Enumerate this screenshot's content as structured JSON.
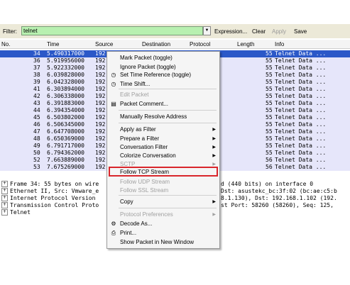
{
  "filter": {
    "label": "Filter:",
    "value": "telnet",
    "actions": [
      "Expression...",
      "Clear",
      "Apply",
      "Save"
    ]
  },
  "columns": [
    "No.",
    "Time",
    "Source",
    "Destination",
    "Protocol",
    "Length",
    "Info"
  ],
  "packets": [
    {
      "no": "34",
      "time": "5.490317000",
      "src": "192",
      "len": "55",
      "info": "Telnet Data ..."
    },
    {
      "no": "36",
      "time": "5.919956000",
      "src": "192",
      "len": "55",
      "info": "Telnet Data ..."
    },
    {
      "no": "37",
      "time": "5.922332000",
      "src": "192",
      "len": "55",
      "info": "Telnet Data ..."
    },
    {
      "no": "38",
      "time": "6.039828000",
      "src": "192",
      "len": "55",
      "info": "Telnet Data ..."
    },
    {
      "no": "39",
      "time": "6.042328000",
      "src": "192",
      "len": "55",
      "info": "Telnet Data ..."
    },
    {
      "no": "41",
      "time": "6.303894000",
      "src": "192",
      "len": "55",
      "info": "Telnet Data ..."
    },
    {
      "no": "42",
      "time": "6.306338000",
      "src": "192",
      "len": "55",
      "info": "Telnet Data ..."
    },
    {
      "no": "43",
      "time": "6.391883000",
      "src": "192",
      "len": "55",
      "info": "Telnet Data ..."
    },
    {
      "no": "44",
      "time": "6.394354000",
      "src": "192",
      "len": "55",
      "info": "Telnet Data ..."
    },
    {
      "no": "45",
      "time": "6.503802000",
      "src": "192",
      "len": "55",
      "info": "Telnet Data ..."
    },
    {
      "no": "46",
      "time": "6.506345000",
      "src": "192",
      "len": "55",
      "info": "Telnet Data ..."
    },
    {
      "no": "47",
      "time": "6.647708000",
      "src": "192",
      "len": "55",
      "info": "Telnet Data ..."
    },
    {
      "no": "48",
      "time": "6.650369000",
      "src": "192",
      "len": "55",
      "info": "Telnet Data ..."
    },
    {
      "no": "49",
      "time": "6.791717000",
      "src": "192",
      "len": "55",
      "info": "Telnet Data ..."
    },
    {
      "no": "50",
      "time": "6.794362000",
      "src": "192",
      "len": "55",
      "info": "Telnet Data ..."
    },
    {
      "no": "52",
      "time": "7.663889000",
      "src": "192",
      "len": "56",
      "info": "Telnet Data ..."
    },
    {
      "no": "53",
      "time": "7.675269000",
      "src": "192",
      "len": "56",
      "info": "Telnet Data ..."
    }
  ],
  "details": [
    {
      "left": "Frame 34: 55 bytes on wire",
      "right": "d (440 bits) on interface 0"
    },
    {
      "left": "Ethernet II, Src: Vmware_e",
      "right": "Dst: asustekc_bc:3f:02 (bc:ae:c5:b"
    },
    {
      "left": "Internet Protocol Version",
      "right": "8.1.130), Dst: 192.168.1.102 (192."
    },
    {
      "left": "Transmission Control Proto",
      "right": "st Port: 58260 (58260), Seq: 125,"
    },
    {
      "left": "Telnet",
      "right": ""
    }
  ],
  "menu": {
    "items": [
      {
        "label": "Mark Packet (toggle)"
      },
      {
        "label": "Ignore Packet (toggle)"
      },
      {
        "label": "Set Time Reference (toggle)",
        "icon": "clock-icon"
      },
      {
        "label": "Time Shift...",
        "icon": "clock-icon"
      },
      {
        "label": "Edit Packet",
        "disabled": true
      },
      {
        "label": "Packet Comment...",
        "icon": "comment-icon"
      },
      {
        "label": "Manually Resolve Address"
      },
      {
        "label": "Apply as Filter",
        "submenu": true
      },
      {
        "label": "Prepare a Filter",
        "submenu": true
      },
      {
        "label": "Conversation Filter",
        "submenu": true
      },
      {
        "label": "Colorize Conversation",
        "submenu": true
      },
      {
        "label": "SCTP",
        "submenu": true,
        "disabled": true
      },
      {
        "label": "Follow TCP Stream",
        "highlighted": true
      },
      {
        "label": "Follow UDP Stream",
        "disabled": true
      },
      {
        "label": "Follow SSL Stream",
        "disabled": true
      },
      {
        "label": "Copy",
        "submenu": true
      },
      {
        "label": "Protocol Preferences",
        "submenu": true,
        "disabled": true
      },
      {
        "label": "Decode As...",
        "icon": "decode-icon"
      },
      {
        "label": "Print...",
        "icon": "print-icon"
      },
      {
        "label": "Show Packet in New Window"
      }
    ]
  },
  "colors": {
    "selected_row": "#2b58c8",
    "row": "#e6e6fa",
    "filter_ok": "#b8f0b0",
    "highlight_box": "#d9262c"
  }
}
